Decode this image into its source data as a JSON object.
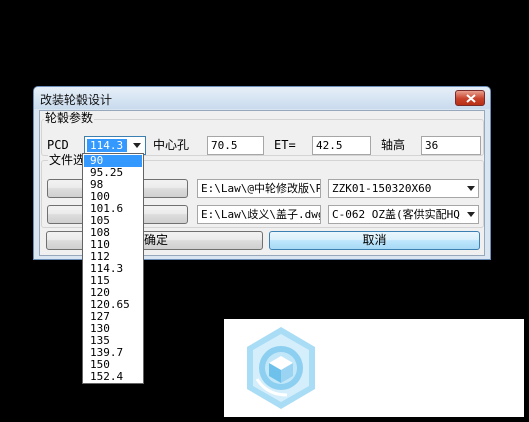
{
  "window": {
    "title": "改装轮毂设计"
  },
  "params": {
    "legend": "轮毂参数",
    "pcd_label": "PCD",
    "pcd_value": "114.3",
    "center_hole_label": "中心孔",
    "center_hole_value": "70.5",
    "et_label": "ET=",
    "et_value": "42.5",
    "axle_height_label": "轴高",
    "axle_height_value": "36"
  },
  "files": {
    "legend": "文件选",
    "row1": {
      "path": "E:\\Law\\@中轮修改版\\P",
      "combo": "ZZK01-150320X60"
    },
    "row2": {
      "path": "E:\\Law\\歧义\\盖子.dwg",
      "combo": "C-062 OZ盖(客供实配HQ"
    }
  },
  "buttons": {
    "ok_fragment": "确定",
    "cancel": "取消"
  },
  "pcd_options": [
    "90",
    "95.25",
    "98",
    "100",
    "101.6",
    "105",
    "108",
    "110",
    "112",
    "114.3",
    "115",
    "120",
    "120.65",
    "127",
    "130",
    "135",
    "139.7",
    "150",
    "152.4"
  ],
  "pcd_highlighted": "90",
  "colors": {
    "selection": "#3399ff",
    "close_button": "#c8422c",
    "logo": "#8ccff0"
  }
}
